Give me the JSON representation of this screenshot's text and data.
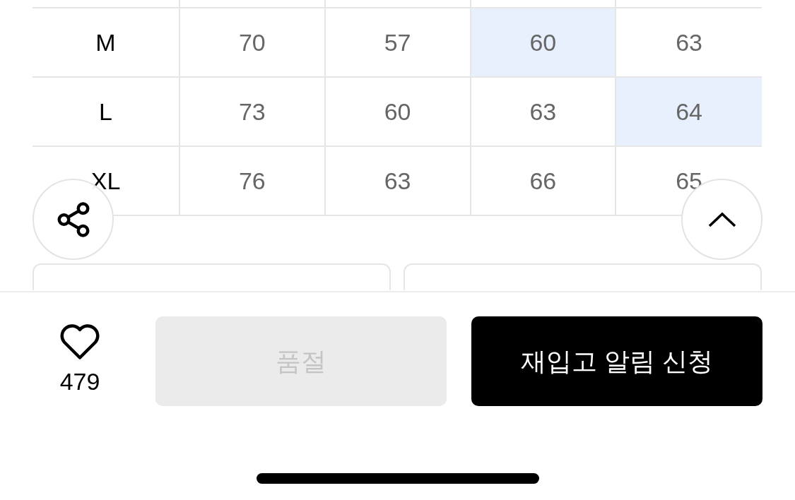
{
  "size_table": {
    "rows": [
      {
        "size": "M",
        "cells": [
          {
            "value": "70",
            "selected": false
          },
          {
            "value": "57",
            "selected": false
          },
          {
            "value": "60",
            "selected": true
          },
          {
            "value": "63",
            "selected": false
          }
        ]
      },
      {
        "size": "L",
        "cells": [
          {
            "value": "73",
            "selected": false
          },
          {
            "value": "60",
            "selected": false
          },
          {
            "value": "63",
            "selected": false
          },
          {
            "value": "64",
            "selected": true
          }
        ]
      },
      {
        "size": "XL",
        "cells": [
          {
            "value": "76",
            "selected": false
          },
          {
            "value": "63",
            "selected": false
          },
          {
            "value": "66",
            "selected": false
          },
          {
            "value": "65",
            "selected": false
          }
        ]
      }
    ]
  },
  "bottom_bar": {
    "like_count": "479",
    "sold_out_button": {
      "label": "품절",
      "disabled": true
    },
    "restock_button": {
      "label": "재입고 알림 신청"
    }
  }
}
